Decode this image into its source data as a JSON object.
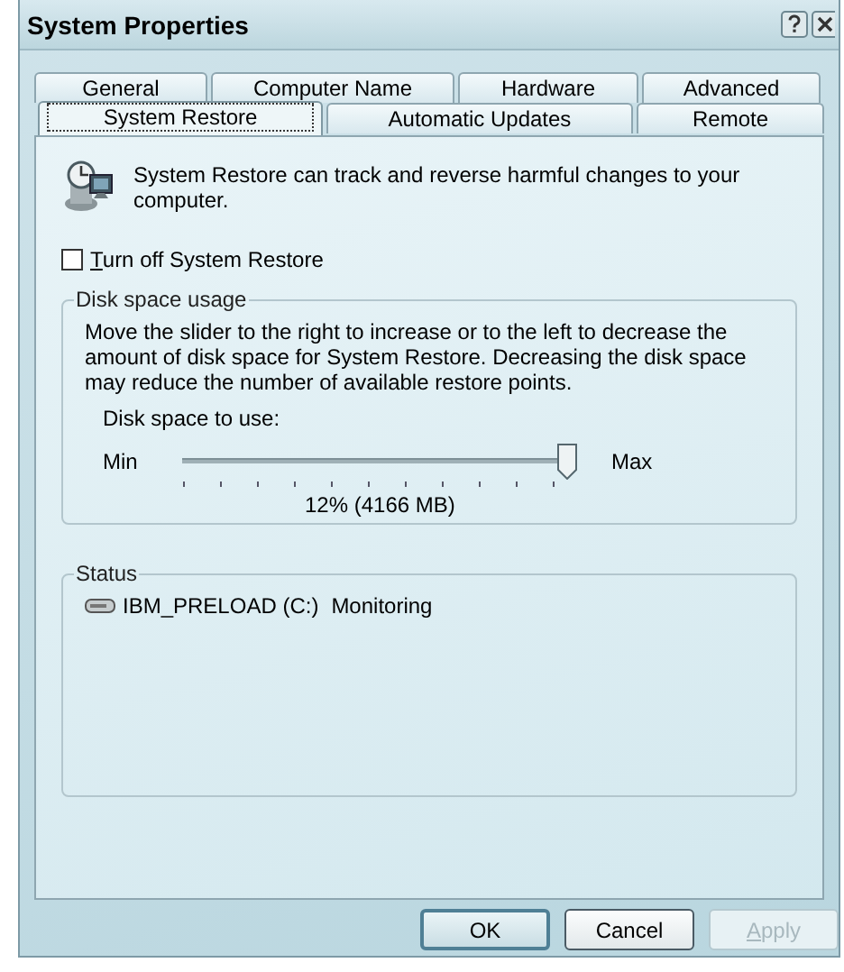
{
  "window": {
    "title": "System Properties"
  },
  "tab_rows": [
    {
      "tabs": [
        {
          "label": "General",
          "selected": false
        },
        {
          "label": "Computer Name",
          "selected": false
        },
        {
          "label": "Hardware",
          "selected": false
        },
        {
          "label": "Advanced",
          "selected": false
        }
      ]
    },
    {
      "tabs": [
        {
          "label": "System Restore",
          "selected": true
        },
        {
          "label": "Automatic Updates",
          "selected": false
        },
        {
          "label": "Remote",
          "selected": false
        }
      ]
    }
  ],
  "intro": "System Restore can track and reverse harmful changes to your computer.",
  "turn_off": {
    "label": "Turn off System Restore",
    "checked": false
  },
  "disk_usage": {
    "legend": "Disk space usage",
    "description": "Move the slider to the right to increase or to the left to decrease the amount of disk space for System Restore. Decreasing the disk space may reduce the number of available restore points.",
    "slider_label": "Disk space to use:",
    "min_label": "Min",
    "max_label": "Max",
    "level": 1,
    "reading": "12% (4166 MB)"
  },
  "status": {
    "legend": "Status",
    "drives": [
      {
        "name": "IBM_PRELOAD (C:)",
        "state": "Monitoring"
      }
    ]
  },
  "buttons": [
    {
      "label": "OK",
      "default": true,
      "disabled": false
    },
    {
      "label": "Cancel",
      "default": false,
      "disabled": false
    },
    {
      "label": "Apply",
      "default": false,
      "disabled": true
    }
  ]
}
